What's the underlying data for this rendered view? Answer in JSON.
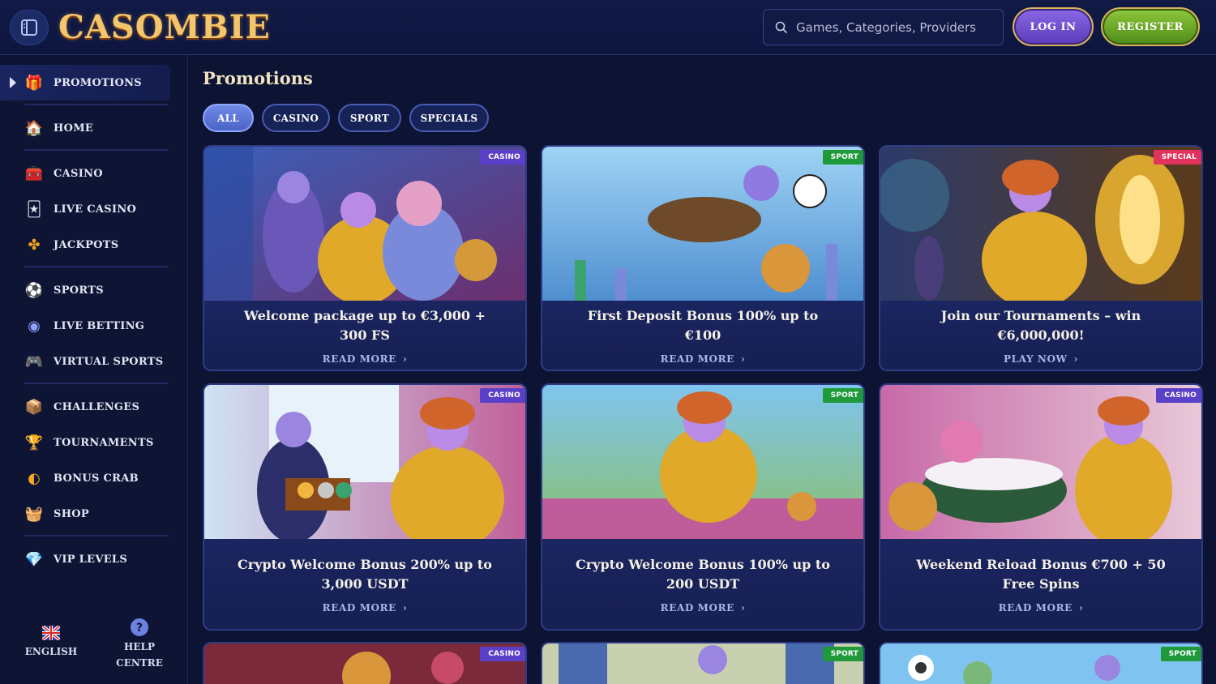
{
  "header": {
    "logo_text": "CASOMBIE",
    "search_placeholder": "Games, Categories, Providers",
    "login_label": "LOG IN",
    "register_label": "REGISTER"
  },
  "sidebar": {
    "items": [
      {
        "label": "PROMOTIONS",
        "icon": "gift-icon",
        "active": true
      },
      {
        "label": "HOME",
        "icon": "house-icon"
      },
      {
        "label": "CASINO",
        "icon": "chest-icon"
      },
      {
        "label": "LIVE CASINO",
        "icon": "cards-icon"
      },
      {
        "label": "JACKPOTS",
        "icon": "clover-icon"
      },
      {
        "label": "SPORTS",
        "icon": "soccer-ball-icon"
      },
      {
        "label": "LIVE BETTING",
        "icon": "live-ball-icon"
      },
      {
        "label": "VIRTUAL SPORTS",
        "icon": "gamepad-icon"
      },
      {
        "label": "CHALLENGES",
        "icon": "treasure-icon"
      },
      {
        "label": "TOURNAMENTS",
        "icon": "trophy-icon"
      },
      {
        "label": "BONUS CRAB",
        "icon": "crab-icon"
      },
      {
        "label": "SHOP",
        "icon": "basket-icon"
      },
      {
        "label": "VIP LEVELS",
        "icon": "gem-icon"
      }
    ],
    "language_label": "ENGLISH",
    "help_label_1": "HELP",
    "help_label_2": "CENTRE"
  },
  "main": {
    "title": "Promotions",
    "filters": [
      {
        "label": "ALL",
        "active": true
      },
      {
        "label": "CASINO"
      },
      {
        "label": "SPORT"
      },
      {
        "label": "SPECIALS"
      }
    ],
    "cards": [
      {
        "title": "Welcome package up to €3,000 + 300 FS",
        "link": "READ MORE",
        "badge": "CASINO"
      },
      {
        "title": "First Deposit Bonus 100% up to €100",
        "link": "READ MORE",
        "badge": "SPORT"
      },
      {
        "title": "Join our Tournaments – win €6,000,000!",
        "link": "PLAY NOW",
        "badge": "SPECIAL"
      },
      {
        "title": "Crypto Welcome Bonus 200% up to 3,000 USDT",
        "link": "READ MORE",
        "badge": "CASINO"
      },
      {
        "title": "Crypto Welcome Bonus 100% up to 200 USDT",
        "link": "READ MORE",
        "badge": "SPORT"
      },
      {
        "title": "Weekend Reload Bonus €700 + 50 Free Spins",
        "link": "READ MORE",
        "badge": "CASINO"
      },
      {
        "badge": "CASINO"
      },
      {
        "badge": "SPORT"
      },
      {
        "badge": "SPORT"
      }
    ]
  },
  "colors": {
    "casino_badge": "#5a3fc8",
    "sport_badge": "#1f9a3a",
    "special_badge": "#e0325a",
    "accent_gold": "#d9b35a"
  }
}
